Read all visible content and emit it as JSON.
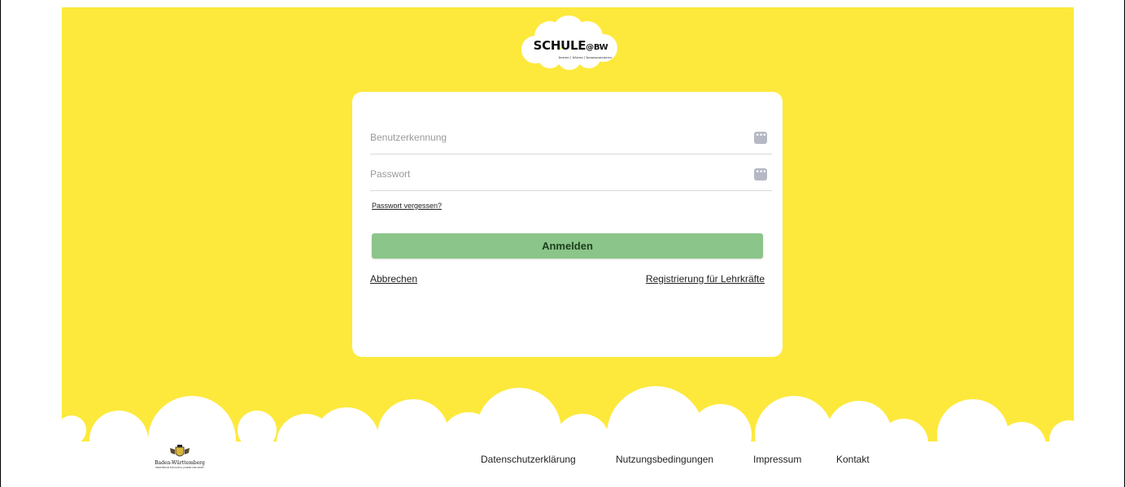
{
  "brand": {
    "title": "SCHULE",
    "title_suffix": "@BW",
    "tagline": "lernen | lehren | kommunizieren"
  },
  "login": {
    "username": {
      "value": "",
      "placeholder": "Benutzerkennung",
      "icon": "password-manager-icon"
    },
    "password": {
      "value": "",
      "placeholder": "Passwort",
      "icon": "password-manager-icon"
    },
    "key_glyph": "•••",
    "forgot_label": "Passwort vergessen?",
    "submit_label": "Anmelden",
    "cancel_label": "Abbrechen",
    "register_label": "Registrierung für Lehrkräfte"
  },
  "footer": {
    "logo_name": "Baden-Württemberg",
    "logo_ministry": "MINISTERIUM FÜR KULTUS, JUGEND UND SPORT",
    "links": [
      "Datenschutzerklärung",
      "Nutzungsbedingungen",
      "Impressum",
      "Kontakt"
    ]
  },
  "colors": {
    "background": "#fde93c",
    "card": "#ffffff",
    "button": "#8bc589",
    "cloud": "#ffffff"
  }
}
